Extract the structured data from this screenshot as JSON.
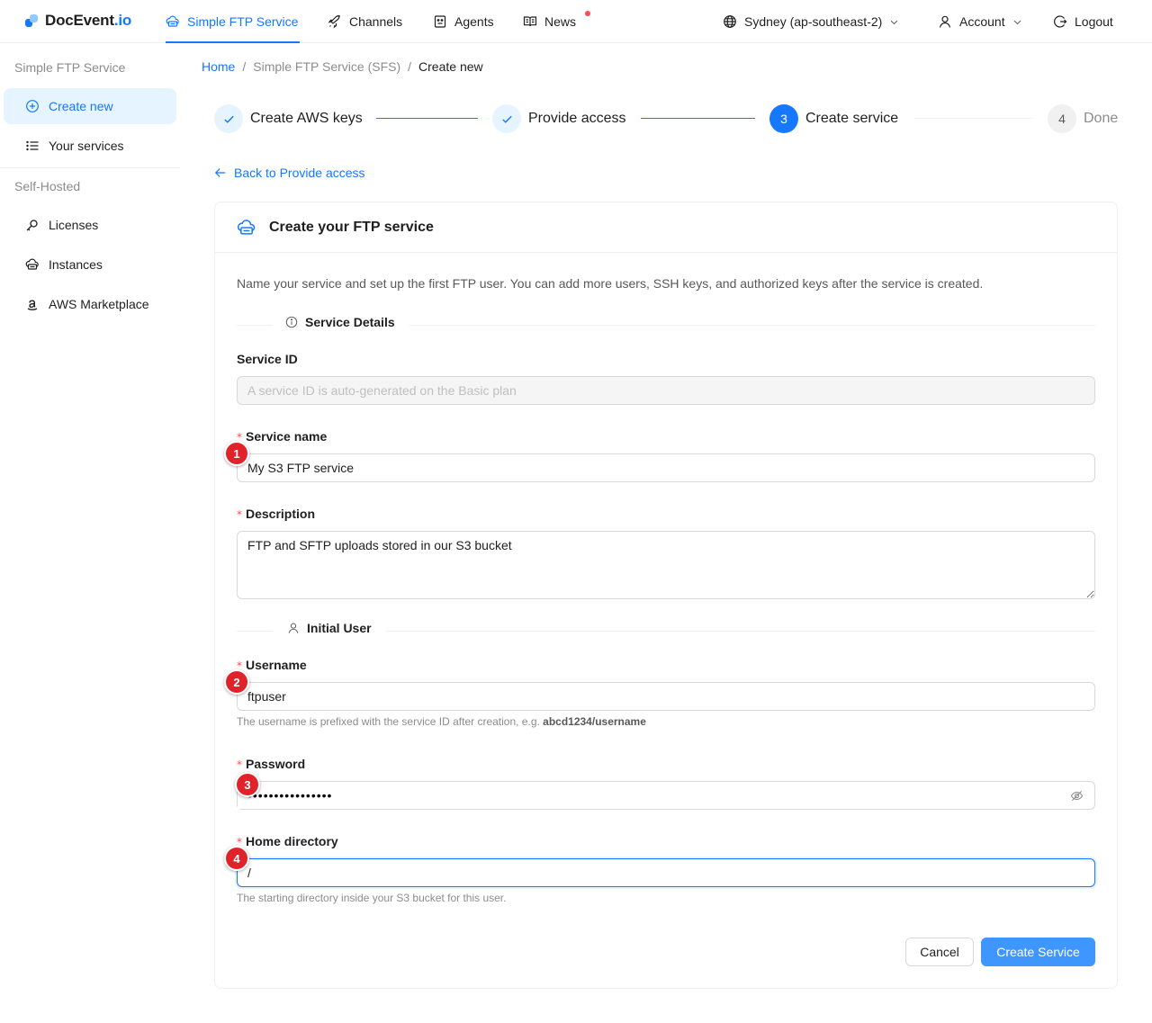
{
  "brand": {
    "name": "DocEvent",
    "suffix": ".io"
  },
  "nav": {
    "items": [
      {
        "label": "Simple FTP Service",
        "icon": "cloud-server-icon",
        "active": true
      },
      {
        "label": "Channels",
        "icon": "rocket-icon"
      },
      {
        "label": "Agents",
        "icon": "robot-icon"
      },
      {
        "label": "News",
        "icon": "book-icon",
        "has_dot": true
      }
    ],
    "region": "Sydney (ap-southeast-2)",
    "account": "Account",
    "logout": "Logout"
  },
  "sidebar": {
    "group1": "Simple FTP Service",
    "items1": [
      {
        "label": "Create new",
        "icon": "plus-circle-icon",
        "active": true
      },
      {
        "label": "Your services",
        "icon": "list-icon"
      }
    ],
    "group2": "Self-Hosted",
    "items2": [
      {
        "label": "Licenses",
        "icon": "key-icon"
      },
      {
        "label": "Instances",
        "icon": "cloud-icon"
      },
      {
        "label": "AWS Marketplace",
        "icon": "amazon-icon"
      }
    ]
  },
  "breadcrumb": {
    "home": "Home",
    "service": "Simple FTP Service (SFS)",
    "current": "Create new",
    "sep": "/"
  },
  "steps": [
    {
      "label": "Create AWS keys",
      "status": "finish"
    },
    {
      "label": "Provide access",
      "status": "finish"
    },
    {
      "label": "Create service",
      "status": "process",
      "number": "3"
    },
    {
      "label": "Done",
      "status": "wait",
      "number": "4"
    }
  ],
  "back_link": "Back to Provide access",
  "card": {
    "title": "Create your FTP service",
    "intro": "Name your service and set up the first FTP user. You can add more users, SSH keys, and authorized keys after the service is created."
  },
  "sections": {
    "details": "Service Details",
    "user": "Initial User"
  },
  "form": {
    "service_id": {
      "label": "Service ID",
      "placeholder": "A service ID is auto-generated on the Basic plan"
    },
    "service_name": {
      "label": "Service name",
      "value": "My S3 FTP service"
    },
    "description": {
      "label": "Description",
      "value": "FTP and SFTP uploads stored in our S3 bucket"
    },
    "username": {
      "label": "Username",
      "value": "ftpuser",
      "help": "The username is prefixed with the service ID after creation, e.g. ",
      "help_example": "abcd1234/username"
    },
    "password": {
      "label": "Password",
      "value": "••••••••••••••••"
    },
    "home_dir": {
      "label": "Home directory",
      "value": "/",
      "help": "The starting directory inside your S3 bucket for this user."
    },
    "required_mark": "*"
  },
  "badges": [
    "1",
    "2",
    "3",
    "4"
  ],
  "buttons": {
    "cancel": "Cancel",
    "submit": "Create Service"
  },
  "colors": {
    "primary": "#1677ff",
    "primary_btn": "#4096ff",
    "badge": "#e0232b",
    "required": "#ff4d4f"
  }
}
